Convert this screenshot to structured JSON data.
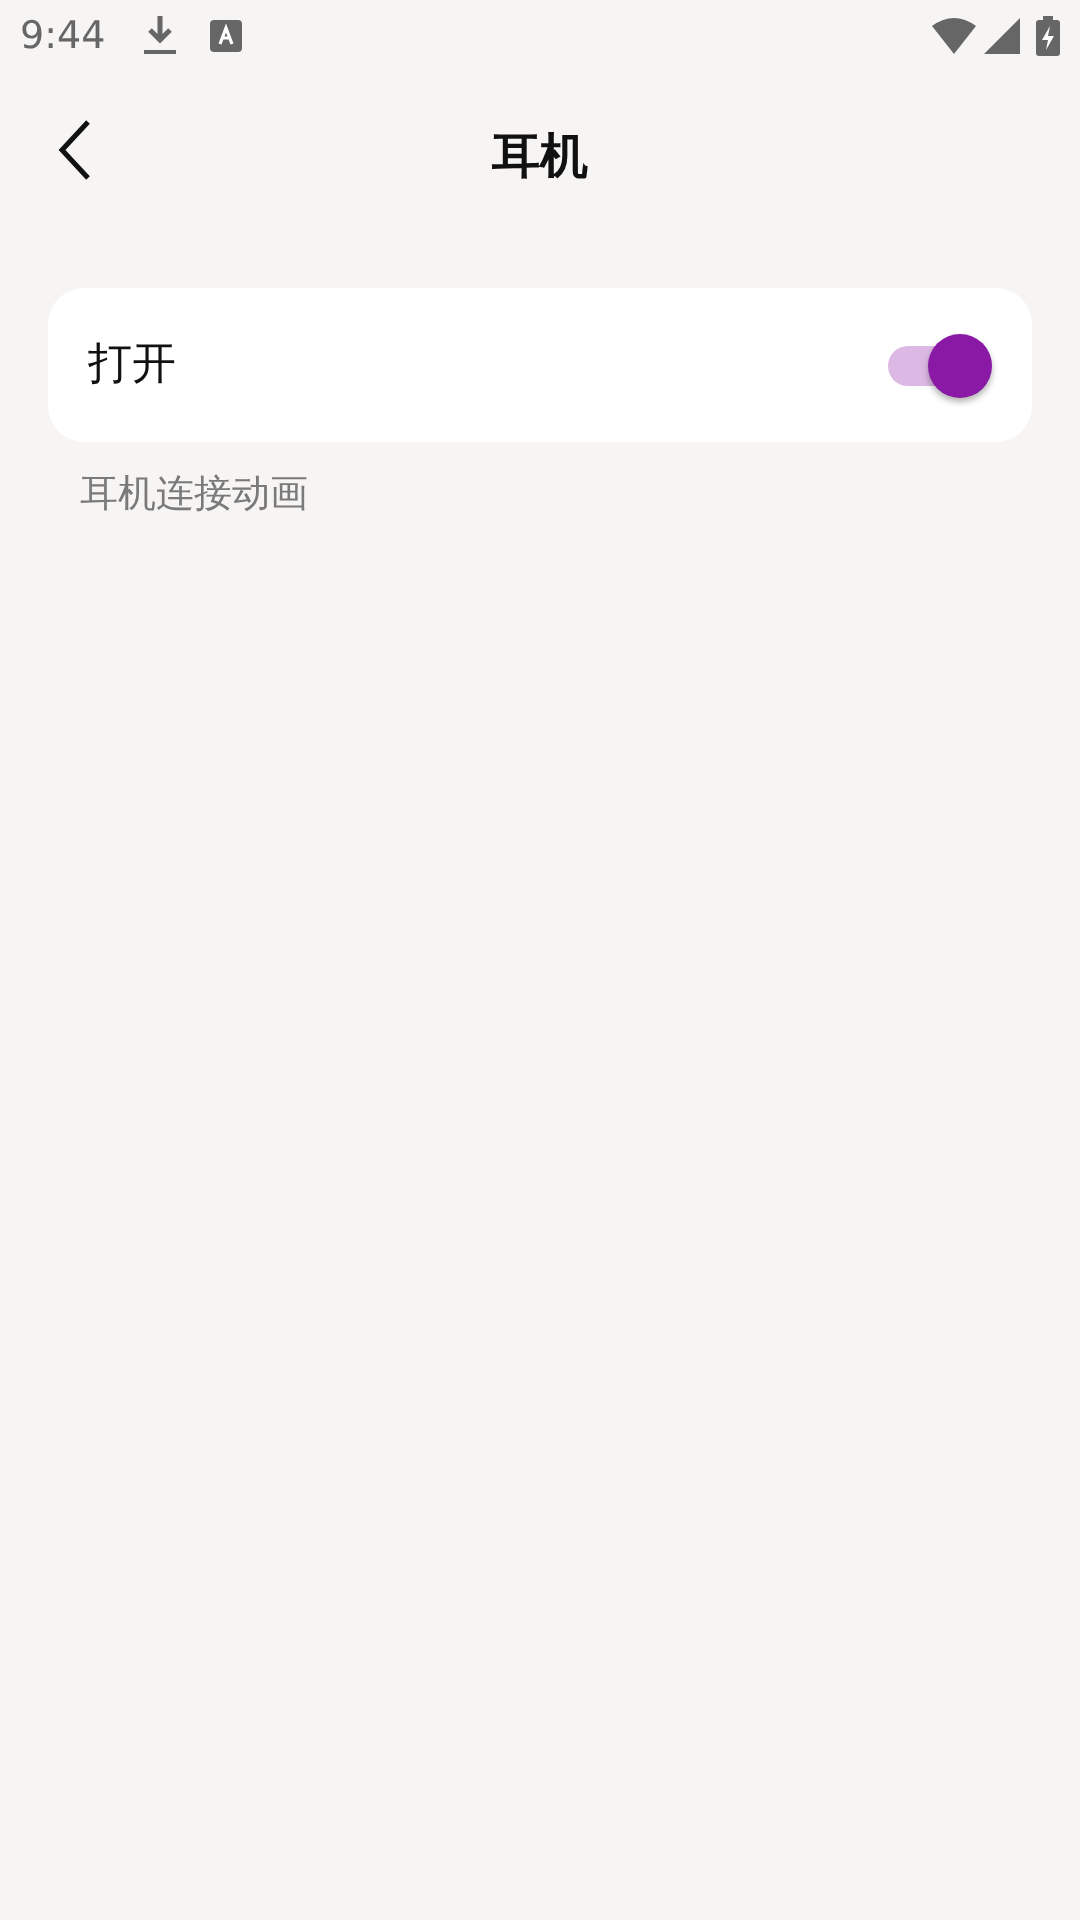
{
  "status_bar": {
    "time": "9:44"
  },
  "header": {
    "title": "耳机"
  },
  "setting": {
    "label": "打开",
    "on": true
  },
  "description": "耳机连接动画"
}
